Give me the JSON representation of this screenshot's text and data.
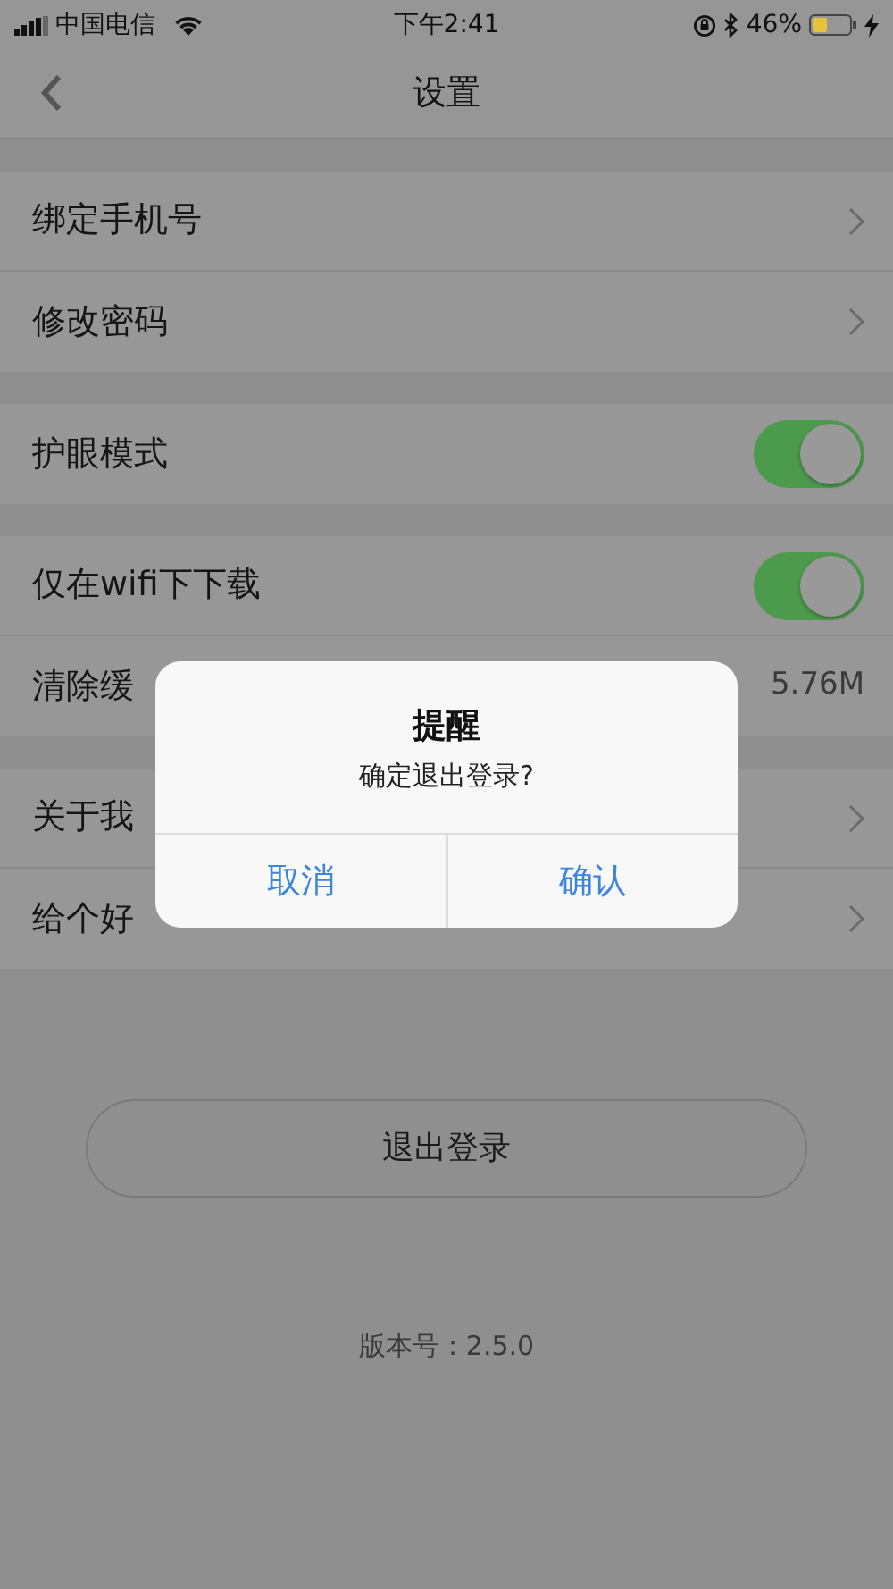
{
  "status_bar": {
    "carrier": "中国电信",
    "time": "下午2:41",
    "battery": "46%"
  },
  "nav": {
    "title": "设置"
  },
  "groups": [
    {
      "rows": [
        {
          "kind": "link",
          "label": "绑定手机号"
        },
        {
          "kind": "link",
          "label": "修改密码"
        }
      ]
    },
    {
      "rows": [
        {
          "kind": "toggle",
          "label": "护眼模式",
          "on": true
        }
      ]
    },
    {
      "rows": [
        {
          "kind": "toggle",
          "label": "仅在wifi下下载",
          "on": true
        },
        {
          "kind": "value",
          "label": "清除缓",
          "value": "5.76M"
        }
      ]
    },
    {
      "rows": [
        {
          "kind": "link",
          "label": "关于我"
        },
        {
          "kind": "link",
          "label": "给个好"
        }
      ]
    }
  ],
  "logout_button": "退出登录",
  "version": "版本号：2.5.0",
  "dialog": {
    "title": "提醒",
    "message": "确定退出登录?",
    "buttons": [
      "取消",
      "确认"
    ]
  }
}
